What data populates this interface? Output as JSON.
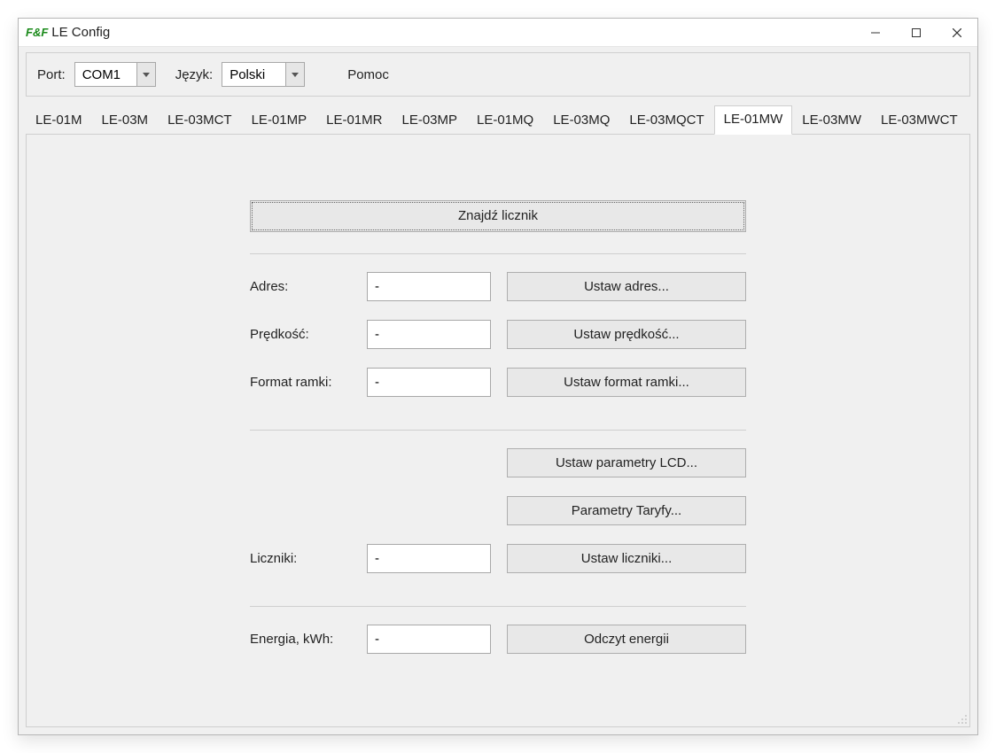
{
  "window": {
    "logo": "F&F",
    "title": "LE Config"
  },
  "toolbar": {
    "port_label": "Port:",
    "port_value": "COM1",
    "lang_label": "Język:",
    "lang_value": "Polski",
    "help_label": "Pomoc"
  },
  "tabs": [
    {
      "label": "LE-01M",
      "active": false
    },
    {
      "label": "LE-03M",
      "active": false
    },
    {
      "label": "LE-03MCT",
      "active": false
    },
    {
      "label": "LE-01MP",
      "active": false
    },
    {
      "label": "LE-01MR",
      "active": false
    },
    {
      "label": "LE-03MP",
      "active": false
    },
    {
      "label": "LE-01MQ",
      "active": false
    },
    {
      "label": "LE-03MQ",
      "active": false
    },
    {
      "label": "LE-03MQCT",
      "active": false
    },
    {
      "label": "LE-01MW",
      "active": true
    },
    {
      "label": "LE-03MW",
      "active": false
    },
    {
      "label": "LE-03MWCT",
      "active": false
    }
  ],
  "panel": {
    "find_button": "Znajdź licznik",
    "rows": {
      "address": {
        "label": "Adres:",
        "value": "-",
        "button": "Ustaw adres..."
      },
      "speed": {
        "label": "Prędkość:",
        "value": "-",
        "button": "Ustaw prędkość..."
      },
      "frame": {
        "label": "Format ramki:",
        "value": "-",
        "button": "Ustaw format ramki..."
      },
      "lcd": {
        "button": "Ustaw parametry LCD..."
      },
      "tariff": {
        "button": "Parametry Taryfy..."
      },
      "counters": {
        "label": "Liczniki:",
        "value": "-",
        "button": "Ustaw liczniki..."
      },
      "energy": {
        "label": "Energia, kWh:",
        "value": "-",
        "button": "Odczyt energii"
      }
    }
  }
}
